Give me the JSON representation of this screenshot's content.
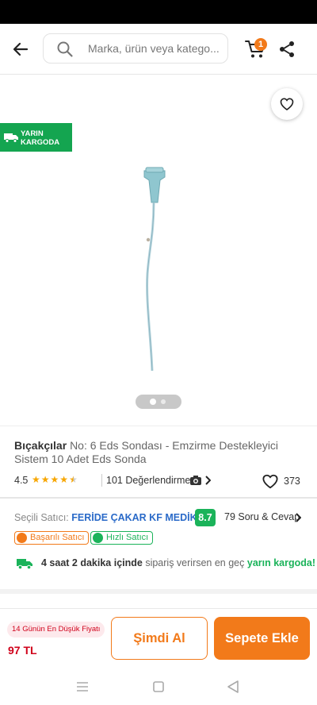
{
  "search": {
    "placeholder": "Marka, ürün veya katego..."
  },
  "header": {
    "cart_count": "1"
  },
  "gallery": {
    "cargo_badge_line1": "YARIN",
    "cargo_badge_line2": "KARGODA",
    "page_count": 2,
    "current_page": 1
  },
  "product": {
    "brand": "Bıçakçılar",
    "title": "No: 6 Eds Sondası - Emzirme Destekleyici Sistem 10 Adet Eds Sonda",
    "rating": "4.5",
    "rating_value": 4.5,
    "rating_max": 5,
    "review_count": "101 Değerlendirme",
    "favorite_count": "373"
  },
  "seller": {
    "label": "Seçili Satıcı:",
    "name": "FERİDE ÇAKAR KF MEDİKAL",
    "score": "8.7",
    "qa": "79 Soru & Cevap",
    "tags": [
      "Başarılı Satıcı",
      "Hızlı Satıcı"
    ],
    "delivery_time": "4 saat 2 dakika içinde",
    "delivery_middle": " sipariş verirsen en geç ",
    "delivery_cargo": "yarın kargoda!"
  },
  "bottom": {
    "low_price_badge": "14 Günün En Düşük Fiyatı",
    "price": "97 TL",
    "buy_now": "Şimdi Al",
    "add_to_cart": "Sepete Ekle"
  },
  "colors": {
    "accent": "#f27a1a",
    "green": "#1bb35a",
    "price_red": "#d0021b",
    "link_blue": "#2a6ac8"
  }
}
